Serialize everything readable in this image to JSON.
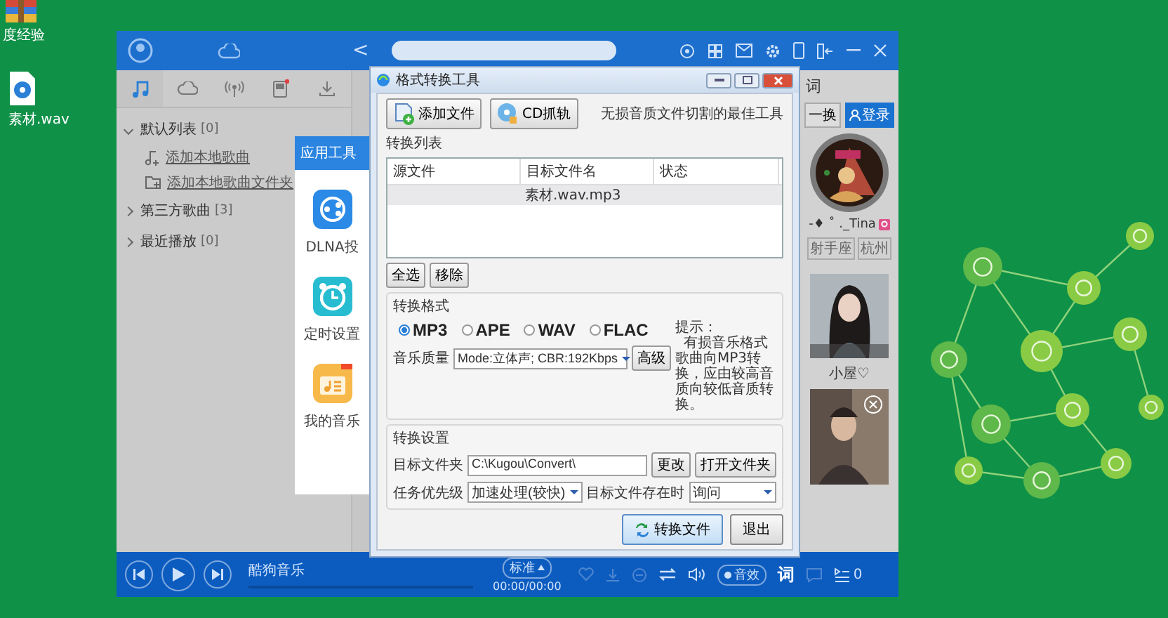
{
  "desktop_icons": [
    {
      "kind": "archive",
      "label": "度经验"
    },
    {
      "kind": "audio",
      "label": "素材.wav"
    }
  ],
  "player": {
    "back": "<",
    "nav_tabs": [
      {
        "kind": "music",
        "selected": true
      },
      {
        "kind": "cloud",
        "selected": false
      },
      {
        "kind": "radio",
        "selected": false
      },
      {
        "kind": "device",
        "selected": false
      },
      {
        "kind": "download",
        "selected": false
      }
    ],
    "playlists": [
      {
        "title": "默认列表",
        "count": "[0]",
        "expanded": true,
        "actions": [
          {
            "kind": "song",
            "label": "添加本地歌曲"
          },
          {
            "kind": "folder",
            "label": "添加本地歌曲文件夹"
          }
        ]
      },
      {
        "title": "第三方歌曲",
        "count": "[3]",
        "expanded": false
      },
      {
        "title": "最近播放",
        "count": "[0]",
        "expanded": false
      }
    ],
    "tools_panel": {
      "title": "应用工具",
      "items": [
        {
          "kind": "dlna",
          "label": "DLNA投"
        },
        {
          "kind": "timer",
          "label": "定时设置"
        },
        {
          "kind": "library",
          "label": "我的音乐"
        }
      ]
    },
    "right_panel": {
      "header": "词",
      "refresh": "一换",
      "login": "登录",
      "user_name": "-♦ ˚ ._Tina",
      "tags": [
        "射手座",
        "杭州"
      ],
      "card_caption": "小屋♡"
    },
    "bottom": {
      "app_name": "酷狗音乐",
      "level": 0,
      "quality": "标准",
      "time": "00:00/00:00",
      "effect": "音效",
      "lyrics": "词",
      "queue_count": "0"
    }
  },
  "dialog": {
    "title": "格式转换工具",
    "toolbar": [
      {
        "kind": "add",
        "label": "添加文件"
      },
      {
        "kind": "cd",
        "label": "CD抓轨"
      }
    ],
    "tagline": "无损音质文件切割的最佳工具",
    "list": {
      "title": "转换列表",
      "columns": [
        "源文件",
        "目标文件名",
        "状态"
      ],
      "rows": [
        {
          "target": "素材.wav.mp3",
          "selected": true
        }
      ],
      "buttons": [
        "全选",
        "移除"
      ]
    },
    "format": {
      "title": "转换格式",
      "options": [
        {
          "label": "MP3",
          "selected": true
        },
        {
          "label": "APE",
          "selected": false
        },
        {
          "label": "WAV",
          "selected": false
        },
        {
          "label": "FLAC",
          "selected": false
        }
      ],
      "quality_label": "音乐质量",
      "quality": "Mode:立体声; CBR:192Kbps",
      "advanced": "高级",
      "hint_title": "提示：",
      "hint": "有损音乐格式歌曲向MP3转换，应由较高音质向较低音质转换。"
    },
    "settings": {
      "title": "转换设置",
      "folder_label": "目标文件夹",
      "folder": "C:\\Kugou\\Convert\\",
      "change": "更改",
      "open": "打开文件夹",
      "priority_label": "任务优先级",
      "priority": "加速处理(较快)",
      "exists_label": "目标文件存在时",
      "exists": "询问"
    },
    "actions": [
      {
        "kind": "primary",
        "label": "转换文件"
      },
      {
        "kind": "normal",
        "label": "退出"
      }
    ]
  }
}
